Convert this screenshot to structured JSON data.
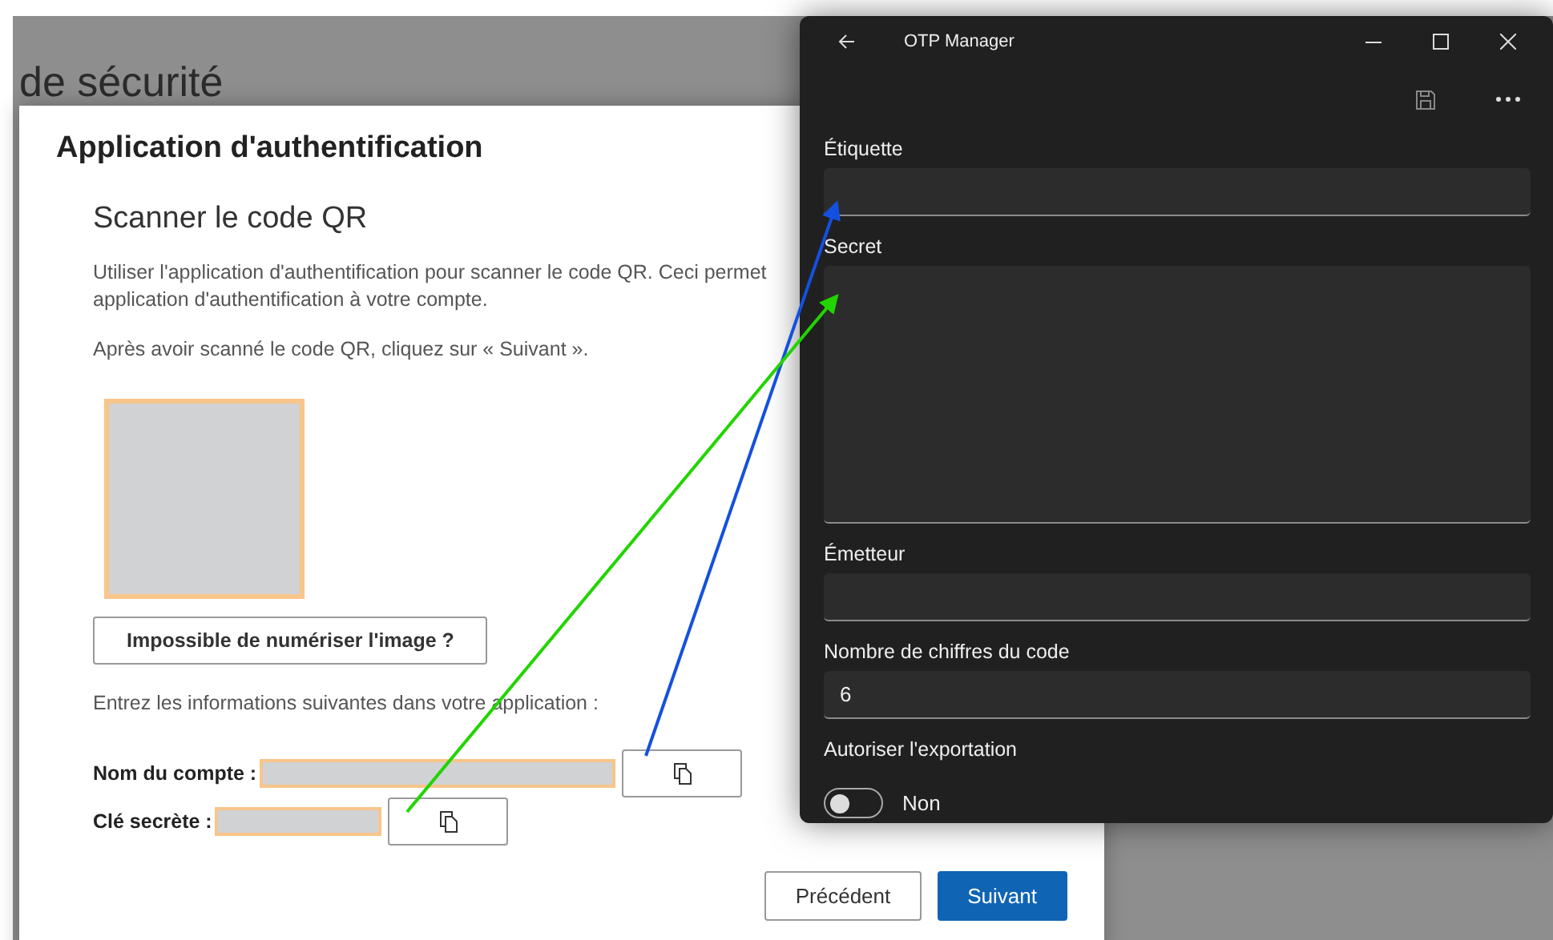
{
  "background_page": {
    "heading": "de sécurité"
  },
  "dialog": {
    "title": "Application d'authentification",
    "subtitle": "Scanner le code QR",
    "intro_lines": [
      "Utiliser l'application d'authentification pour scanner le code QR. Ceci permet",
      "application d'authentification à votre compte."
    ],
    "hint": "Après avoir scanné le code QR, cliquez sur « Suivant ».",
    "cant_scan_button": "Impossible de numériser l'image ?",
    "instructions": "Entrez les informations suivantes dans votre application :",
    "fields": [
      {
        "label": "Nom du compte :",
        "kind": "long"
      },
      {
        "label": "Clé secrète :",
        "kind": "short"
      }
    ],
    "buttons": [
      {
        "label": "Précédent",
        "kind": "secondary"
      },
      {
        "label": "Suivant",
        "kind": "primary"
      }
    ]
  },
  "otp_window": {
    "title": "OTP Manager",
    "fields": [
      {
        "label": "Étiquette",
        "kind": "line"
      },
      {
        "label": "Secret",
        "kind": "multiline"
      },
      {
        "label": "Émetteur",
        "kind": "line"
      },
      {
        "label": "Nombre de chiffres du code",
        "kind": "line",
        "value": "6"
      }
    ],
    "toggle": {
      "label": "Autoriser l'exportation",
      "on": false,
      "state_text": "Non"
    }
  },
  "arrows": [
    {
      "color": "#1450e0"
    },
    {
      "color": "#22d400"
    }
  ]
}
